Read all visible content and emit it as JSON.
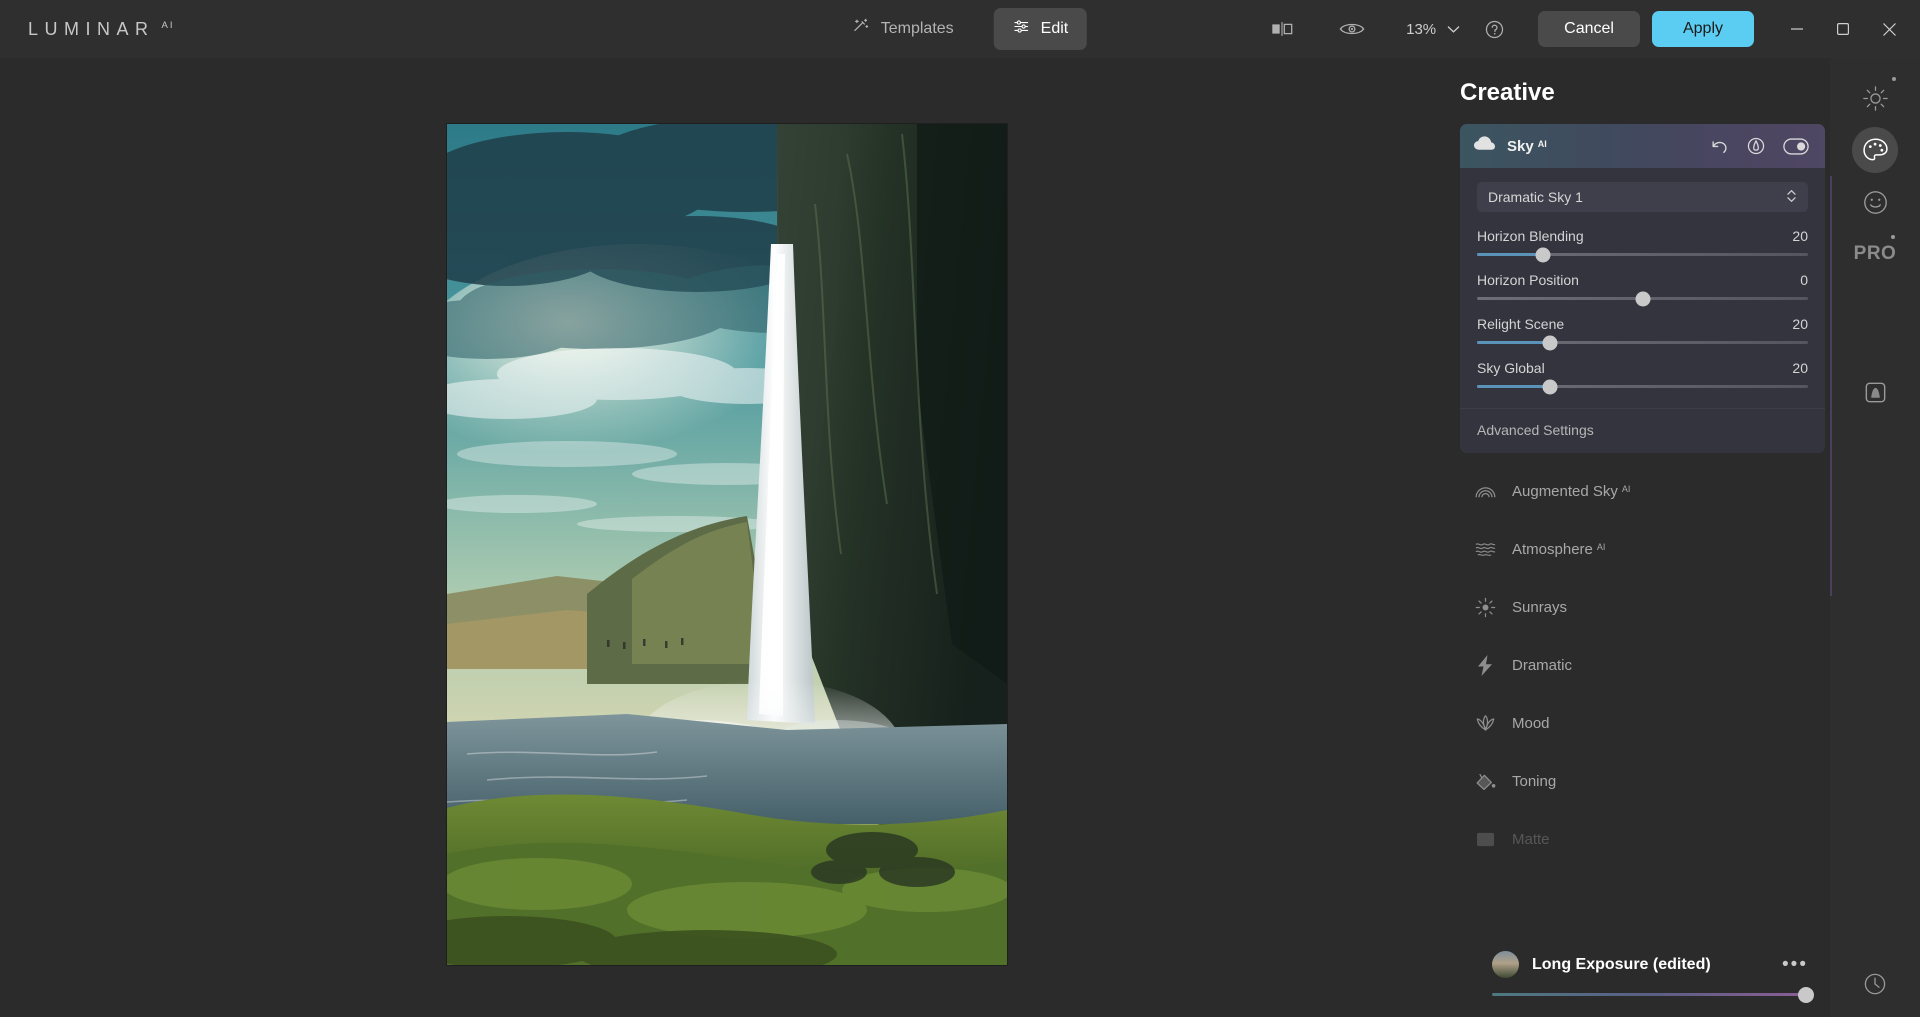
{
  "app": {
    "logo": "LUMINAR",
    "logo_sup": "AI"
  },
  "progress": {
    "percent": 20
  },
  "header": {
    "tabs": [
      {
        "label": "Templates",
        "icon": "magic-wand-icon",
        "active": false
      },
      {
        "label": "Edit",
        "icon": "sliders-icon",
        "active": true
      }
    ],
    "compare_icon": "compare-split-icon",
    "preview_icon": "eye-icon",
    "zoom_level": "13%",
    "zoom_chevron": "chevron-down-icon",
    "help_icon": "question-circle-icon",
    "cancel_label": "Cancel",
    "apply_label": "Apply",
    "apply_color": "#5ccdf2",
    "window": {
      "minimize": "minimize-icon",
      "maximize": "maximize-icon",
      "close": "close-icon"
    }
  },
  "panel": {
    "title": "Creative",
    "tool": {
      "name": "Sky",
      "sup": "AI",
      "icon": "cloud-icon",
      "actions": [
        "reset-icon",
        "masking-icon",
        "visibility-toggle-icon"
      ],
      "select": {
        "value": "Dramatic Sky 1",
        "chevron": "chevron-updown-icon"
      },
      "sliders": [
        {
          "label": "Horizon Blending",
          "value": 20,
          "min": 0,
          "max": 100,
          "percent": 20,
          "bipolar": false
        },
        {
          "label": "Horizon Position",
          "value": 0,
          "min": -100,
          "max": 100,
          "percent": 50,
          "bipolar": true
        },
        {
          "label": "Relight Scene",
          "value": 20,
          "min": 0,
          "max": 100,
          "percent": 22,
          "bipolar": false
        },
        {
          "label": "Sky Global",
          "value": 20,
          "min": 0,
          "max": 100,
          "percent": 22,
          "bipolar": false
        }
      ],
      "advanced_label": "Advanced Settings"
    },
    "tools": [
      {
        "label": "Augmented Sky",
        "sup": "AI",
        "icon": "rainbow-icon",
        "faded": false
      },
      {
        "label": "Atmosphere",
        "sup": "AI",
        "icon": "waves-icon",
        "faded": false
      },
      {
        "label": "Sunrays",
        "sup": "",
        "icon": "sun-icon",
        "faded": false
      },
      {
        "label": "Dramatic",
        "sup": "",
        "icon": "lightning-icon",
        "faded": false
      },
      {
        "label": "Mood",
        "sup": "",
        "icon": "lotus-icon",
        "faded": false
      },
      {
        "label": "Toning",
        "sup": "",
        "icon": "paint-bucket-icon",
        "faded": false
      },
      {
        "label": "Matte",
        "sup": "",
        "icon": "square-icon",
        "faded": true
      }
    ]
  },
  "bottom": {
    "image_name": "Long Exposure (edited)",
    "menu_icon": "more-dots-icon",
    "thumbnail": "photo-thumbnail",
    "slider_percent": 100
  },
  "rail": {
    "items": [
      {
        "name": "essentials",
        "icon": "sun-icon",
        "active": false
      },
      {
        "name": "creative",
        "icon": "palette-icon",
        "active": true
      },
      {
        "name": "portrait",
        "icon": "smiley-icon",
        "active": false
      },
      {
        "name": "professional",
        "icon": "pro-text-icon",
        "active": false,
        "text": "PRO"
      }
    ],
    "layers_icon": "layers-icon",
    "history_icon": "clock-icon"
  }
}
